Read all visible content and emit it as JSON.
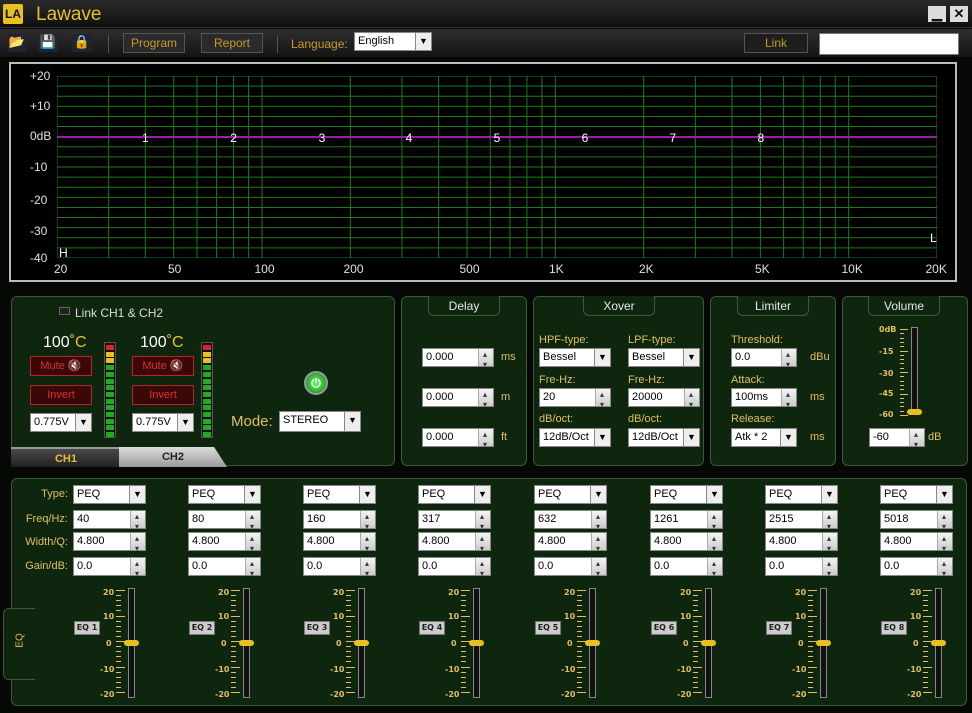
{
  "app": {
    "title": "Lawave",
    "logo": "LA"
  },
  "toolbar": {
    "icons": [
      "open-folder-icon",
      "save-disk-icon",
      "lock-icon"
    ],
    "program_label": "Program",
    "report_label": "Report",
    "language_label": "Language:",
    "language_value": "English",
    "link_label": "Link",
    "link_field_value": ""
  },
  "graph": {
    "y_labels": [
      "+20",
      "+10",
      "0dB",
      "-10",
      "-20",
      "-30",
      "-40"
    ],
    "x_labels": [
      "20",
      "50",
      "100",
      "200",
      "500",
      "1K",
      "2K",
      "5K",
      "10K",
      "20K"
    ],
    "band_markers": [
      "1",
      "2",
      "3",
      "4",
      "5",
      "6",
      "7",
      "8"
    ],
    "h_marker": "H",
    "l_marker": "L",
    "response_color": "#9a1fa8",
    "grid_color": "#1e7a1e"
  },
  "channel": {
    "link_label": "Link CH1 & CH2",
    "ch1": {
      "temp": "100",
      "temp_unit": "˚C",
      "mute_label": "Mute",
      "invert_label": "Invert",
      "sens_value": "0.775V"
    },
    "ch2": {
      "temp": "100",
      "temp_unit": "˚C",
      "mute_label": "Mute",
      "invert_label": "Invert",
      "sens_value": "0.775V"
    },
    "mode_label": "Mode:",
    "mode_value": "STEREO",
    "tabs": [
      "CH1",
      "CH2"
    ],
    "active_tab": "CH1"
  },
  "delay": {
    "title": "Delay",
    "rows": [
      {
        "value": "0.000",
        "unit": "ms"
      },
      {
        "value": "0.000",
        "unit": "m"
      },
      {
        "value": "0.000",
        "unit": "ft"
      }
    ]
  },
  "xover": {
    "title": "Xover",
    "hpf_type_label": "HPF-type:",
    "hpf_type_value": "Bessel",
    "lpf_type_label": "LPF-type:",
    "lpf_type_value": "Bessel",
    "hpf_freq_label": "Fre-Hz:",
    "hpf_freq_value": "20",
    "lpf_freq_label": "Fre-Hz:",
    "lpf_freq_value": "20000",
    "hpf_slope_label": "dB/oct:",
    "hpf_slope_value": "12dB/Oct",
    "lpf_slope_label": "dB/oct:",
    "lpf_slope_value": "12dB/Oct"
  },
  "limiter": {
    "title": "Limiter",
    "threshold_label": "Threshold:",
    "threshold_value": "0.0",
    "threshold_unit": "dBu",
    "attack_label": "Attack:",
    "attack_value": "100ms",
    "attack_unit": "ms",
    "release_label": "Release:",
    "release_value": "Atk * 2",
    "release_unit": "ms"
  },
  "volume": {
    "title": "Volume",
    "scale": [
      "0dB",
      "-15",
      "-30",
      "-45",
      "-60"
    ],
    "value": "-60",
    "unit": "dB",
    "level": 0.0
  },
  "eq": {
    "side_label": "EQ",
    "row_labels": {
      "type": "Type:",
      "freq": "Freq/Hz:",
      "width": "Width/Q:",
      "gain": "Gain/dB:"
    },
    "slider_scale": [
      "20",
      "10",
      "0",
      "-10",
      "-20"
    ],
    "bands": [
      {
        "label": "EQ 1",
        "type": "PEQ",
        "freq": "40",
        "q": "4.800",
        "gain": "0.0",
        "gain_value": 0
      },
      {
        "label": "EQ 2",
        "type": "PEQ",
        "freq": "80",
        "q": "4.800",
        "gain": "0.0",
        "gain_value": 0
      },
      {
        "label": "EQ 3",
        "type": "PEQ",
        "freq": "160",
        "q": "4.800",
        "gain": "0.0",
        "gain_value": 0
      },
      {
        "label": "EQ 4",
        "type": "PEQ",
        "freq": "317",
        "q": "4.800",
        "gain": "0.0",
        "gain_value": 0
      },
      {
        "label": "EQ 5",
        "type": "PEQ",
        "freq": "632",
        "q": "4.800",
        "gain": "0.0",
        "gain_value": 0
      },
      {
        "label": "EQ 6",
        "type": "PEQ",
        "freq": "1261",
        "q": "4.800",
        "gain": "0.0",
        "gain_value": 0
      },
      {
        "label": "EQ 7",
        "type": "PEQ",
        "freq": "2515",
        "q": "4.800",
        "gain": "0.0",
        "gain_value": 0
      },
      {
        "label": "EQ 8",
        "type": "PEQ",
        "freq": "5018",
        "q": "4.800",
        "gain": "0.0",
        "gain_value": 0
      }
    ]
  }
}
